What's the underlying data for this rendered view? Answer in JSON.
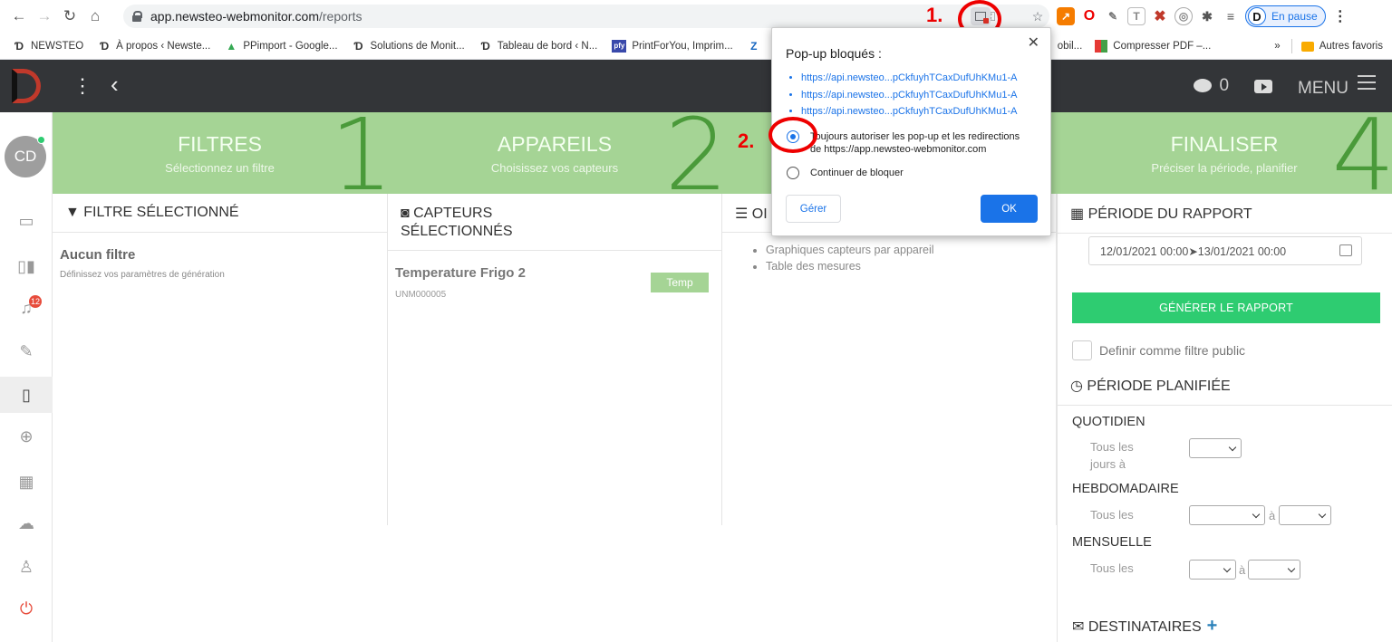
{
  "browser": {
    "url_host": "app.newsteo-webmonitor.com",
    "url_path": "/reports",
    "profile_status": "En pause",
    "profile_initial": "D",
    "bookmarks": [
      {
        "label": "NEWSTEO",
        "icon": "newsteo-favicon"
      },
      {
        "label": "À propos ‹ Newste...",
        "icon": "newsteo-favicon"
      },
      {
        "label": "PPimport - Google...",
        "icon": "google-drive-icon"
      },
      {
        "label": "Solutions de Monit...",
        "icon": "newsteo-favicon"
      },
      {
        "label": "Tableau de bord ‹ N...",
        "icon": "newsteo-favicon"
      },
      {
        "label": "PrintForYou, Imprim...",
        "icon": "pfy-icon"
      },
      {
        "label": "Z",
        "icon": "z-icon"
      }
    ],
    "bookmarks_right": [
      "obil...",
      "Compresser PDF –...",
      "»",
      "Autres favoris"
    ]
  },
  "annotations": {
    "step1": "1.",
    "step2": "2."
  },
  "popup": {
    "title": "Pop-up bloqués :",
    "links": [
      "https://api.newsteo...pCkfuyhTCaxDufUhKMu1-A",
      "https://api.newsteo...pCkfuyhTCaxDufUhKMu1-A",
      "https://api.newsteo...pCkfuyhTCaxDufUhKMu1-A"
    ],
    "option_allow_line1": "Toujours autoriser les pop-up et les redirections",
    "option_allow_line2": "de https://app.newsteo-webmonitor.com",
    "option_block": "Continuer de bloquer",
    "manage": "Gérer",
    "ok": "OK"
  },
  "appbar": {
    "chat_count": "0",
    "menu": "MENU"
  },
  "sidebar": {
    "avatar": "CD",
    "alerts_badge": "12"
  },
  "steps": [
    {
      "title": "FILTRES",
      "subtitle": "Sélectionnez un filtre",
      "number": "1"
    },
    {
      "title": "APPAREILS",
      "subtitle": "Choisissez vos capteurs",
      "number": "2"
    },
    {
      "title": "",
      "subtitle": "",
      "number": ""
    },
    {
      "title": "FINALISER",
      "subtitle": "Préciser la période, planifier",
      "number": "4"
    }
  ],
  "filter": {
    "header": "FILTRE SÉLECTIONNÉ",
    "title": "Aucun filtre",
    "subtitle": "Définissez vos paramètres de génération"
  },
  "sensors": {
    "header_line1": "CAPTEURS",
    "header_line2": "SÉLECTIONNÉS",
    "name": "Temperature Frigo 2",
    "id": "UNM000005",
    "tag": "Temp"
  },
  "options": {
    "header": "OI",
    "items": [
      "Graphiques capteurs par appareil",
      "Table des mesures"
    ]
  },
  "finalize": {
    "period_header": "PÉRIODE DU RAPPORT",
    "date_range": "12/01/2021 00:00➤13/01/2021 00:00",
    "generate": "GÉNÉRER LE RAPPORT",
    "public_filter": "Definir comme filtre public",
    "scheduled_header": "PÉRIODE PLANIFIÉE",
    "daily": "QUOTIDIEN",
    "daily_sub_1": "Tous les",
    "daily_sub_2": "jours à",
    "weekly": "HEBDOMADAIRE",
    "weekly_sub": "Tous les",
    "monthly": "MENSUELLE",
    "monthly_sub": "Tous les",
    "a_sep": "à",
    "recipients": "DESTINATAIRES"
  },
  "colors": {
    "step_bg": "#a5d495",
    "step_number": "#4a9a3a",
    "appbar": "#333538",
    "generate": "#2ecc71",
    "popup_blue": "#1a73e8",
    "annotation_red": "#e00000"
  }
}
